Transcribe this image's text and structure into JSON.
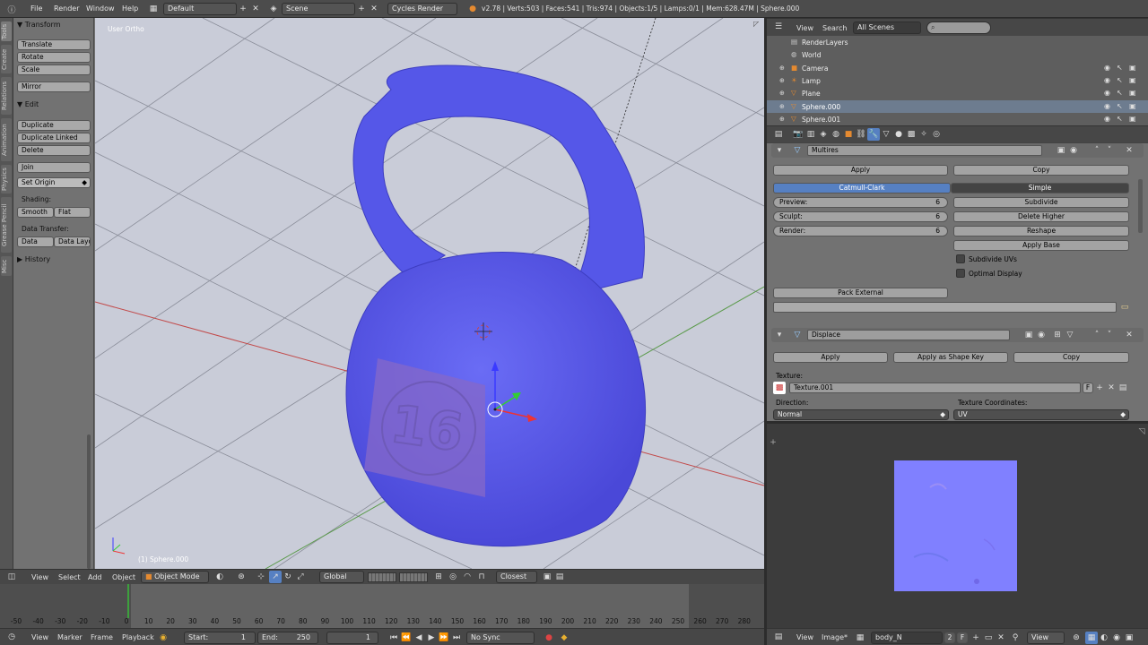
{
  "top_bar": {
    "menus": [
      "File",
      "Render",
      "Window",
      "Help"
    ],
    "screen_layout": "Default",
    "scene": "Scene",
    "render_engine": "Cycles Render",
    "stats": "v2.78 | Verts:503 | Faces:541 | Tris:974 | Objects:1/5 | Lamps:0/1 | Mem:628.47M | Sphere.000"
  },
  "tool_tabs": [
    "Tools",
    "Create",
    "Relations",
    "Animation",
    "Physics",
    "Grease Pencil",
    "Misc"
  ],
  "tool_shelf": {
    "transform_header": "Transform",
    "transform_buttons": [
      "Translate",
      "Rotate",
      "Scale"
    ],
    "mirror": "Mirror",
    "edit_header": "Edit",
    "edit_buttons": [
      "Duplicate",
      "Duplicate Linked",
      "Delete"
    ],
    "join": "Join",
    "set_origin": "Set Origin",
    "shading_label": "Shading:",
    "smooth": "Smooth",
    "flat": "Flat",
    "data_transfer_label": "Data Transfer:",
    "data": "Data",
    "data_layout": "Data Layo",
    "history_header": "History"
  },
  "viewport": {
    "view_label": "User Ortho",
    "object_label": "(1) Sphere.000",
    "model_badge_text": "16"
  },
  "viewport_header": {
    "menus": [
      "View",
      "Select",
      "Add",
      "Object"
    ],
    "mode": "Object Mode",
    "orientation": "Global",
    "snap_target": "Closest"
  },
  "timeline": {
    "ticks": [
      "-50",
      "-40",
      "-30",
      "-20",
      "-10",
      "0",
      "10",
      "20",
      "30",
      "40",
      "50",
      "60",
      "70",
      "80",
      "90",
      "100",
      "110",
      "120",
      "130",
      "140",
      "150",
      "160",
      "170",
      "180",
      "190",
      "200",
      "210",
      "220",
      "230",
      "240",
      "250",
      "260",
      "270",
      "280"
    ],
    "current_frame_value": 1,
    "menus": [
      "View",
      "Marker",
      "Frame",
      "Playback"
    ],
    "start_label": "Start:",
    "start_value": "1",
    "end_label": "End:",
    "end_value": "250",
    "current_frame": "1",
    "sync": "No Sync"
  },
  "outliner": {
    "menus": [
      "View",
      "Search"
    ],
    "scope": "All Scenes",
    "items": [
      {
        "name": "RenderLayers",
        "icon": "render-layers-icon",
        "selected": false
      },
      {
        "name": "World",
        "icon": "world-icon",
        "selected": false
      },
      {
        "name": "Camera",
        "icon": "camera-icon",
        "selected": false
      },
      {
        "name": "Lamp",
        "icon": "lamp-icon",
        "selected": false
      },
      {
        "name": "Plane",
        "icon": "mesh-icon",
        "selected": false
      },
      {
        "name": "Sphere.000",
        "icon": "mesh-icon",
        "selected": true
      },
      {
        "name": "Sphere.001",
        "icon": "mesh-icon",
        "selected": false
      }
    ]
  },
  "properties": {
    "multires": {
      "name": "Multires",
      "apply": "Apply",
      "copy": "Copy",
      "catmull_clark": "Catmull-Clark",
      "simple": "Simple",
      "preview_label": "Preview:",
      "preview_value": "6",
      "sculpt_label": "Sculpt:",
      "sculpt_value": "6",
      "render_label": "Render:",
      "render_value": "6",
      "subdivide": "Subdivide",
      "delete_higher": "Delete Higher",
      "reshape": "Reshape",
      "apply_base": "Apply Base",
      "subdivide_uvs": "Subdivide UVs",
      "optimal_display": "Optimal Display",
      "pack_external": "Pack External"
    },
    "displace": {
      "name": "Displace",
      "apply": "Apply",
      "apply_shape_key": "Apply as Shape Key",
      "copy": "Copy",
      "texture_label": "Texture:",
      "texture_name": "Texture.001",
      "texture_flag": "F",
      "direction_label": "Direction:",
      "direction_value": "Normal",
      "tex_coords_label": "Texture Coordinates:",
      "tex_coords_value": "UV"
    }
  },
  "image_editor": {
    "menus": [
      "View",
      "Image*"
    ],
    "image_name": "body_N",
    "users": "2",
    "flag": "F",
    "view_menu2": "View"
  },
  "colors": {
    "accent_blue": "#5680c2",
    "kettlebell": "#5b5ef0",
    "normal_map": "#8080ff",
    "frame_marker": "#3da03d"
  }
}
